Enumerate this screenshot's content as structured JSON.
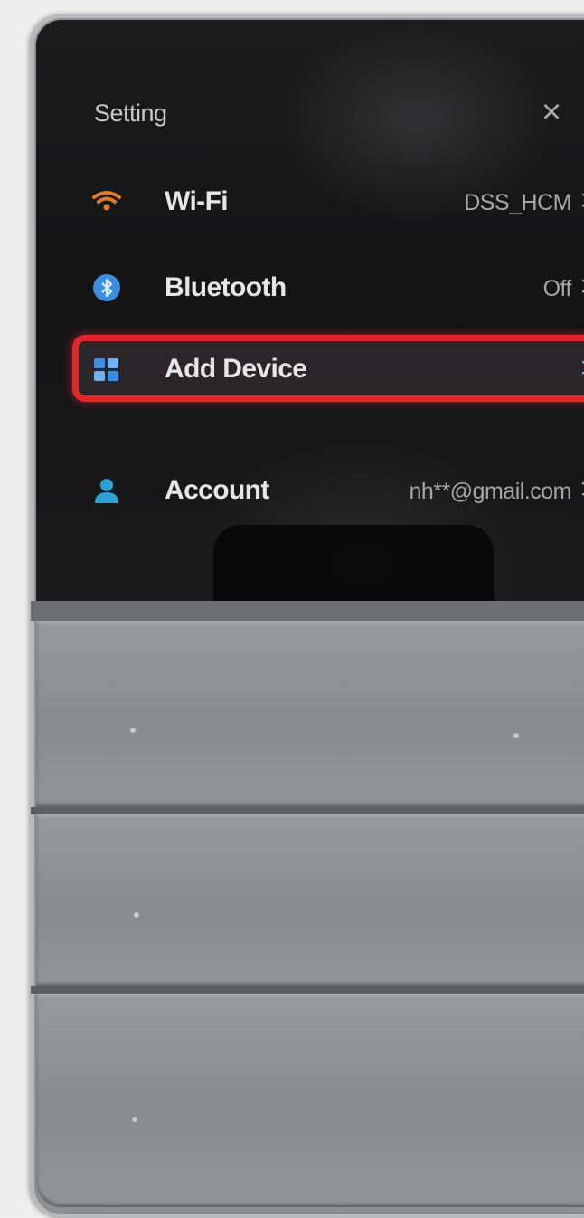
{
  "settings": {
    "title": "Setting",
    "close_icon": "close-icon",
    "items": [
      {
        "label": "Wi-Fi",
        "value": "DSS_HCM",
        "icon": "wifi-icon",
        "icon_color": "#e07b2b"
      },
      {
        "label": "Bluetooth",
        "value": "Off",
        "icon": "bluetooth-icon",
        "icon_color": "#3b8fe0"
      },
      {
        "label": "Add Device",
        "value": "",
        "icon": "add-device-icon",
        "icon_color": "#3b8fe0",
        "highlighted": true
      },
      {
        "label": "Account",
        "value": "nh**@gmail.com",
        "icon": "account-icon",
        "icon_color": "#2f9fd8"
      }
    ],
    "chevron": ">"
  },
  "colors": {
    "highlight": "#e0272a",
    "screen_bg": "#161617",
    "panel": "#8e8f92"
  }
}
